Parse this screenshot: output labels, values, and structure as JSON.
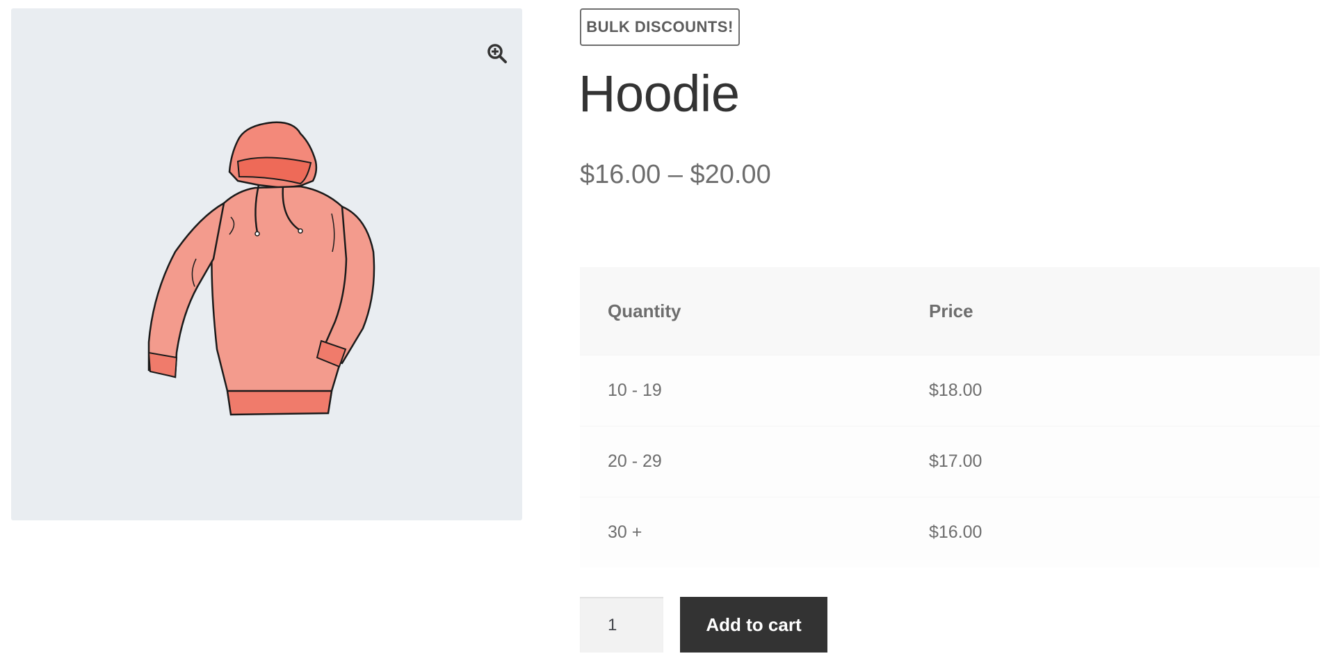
{
  "product": {
    "badge": "BULK DISCOUNTS!",
    "title": "Hoodie",
    "price_range": "$16.00 – $20.00",
    "image_icon": "hoodie-illustration",
    "zoom_icon": "zoom-in-icon"
  },
  "pricing_table": {
    "headers": [
      "Quantity",
      "Price"
    ],
    "rows": [
      [
        "10 - 19",
        "$18.00"
      ],
      [
        "20 - 29",
        "$17.00"
      ],
      [
        "30 +",
        "$16.00"
      ]
    ]
  },
  "cart": {
    "quantity_value": "1",
    "add_label": "Add to cart"
  },
  "colors": {
    "gallery_bg": "#e9edf1",
    "hoodie": "#f3897a",
    "button_bg": "#333333",
    "text": "#6d6d6d"
  }
}
